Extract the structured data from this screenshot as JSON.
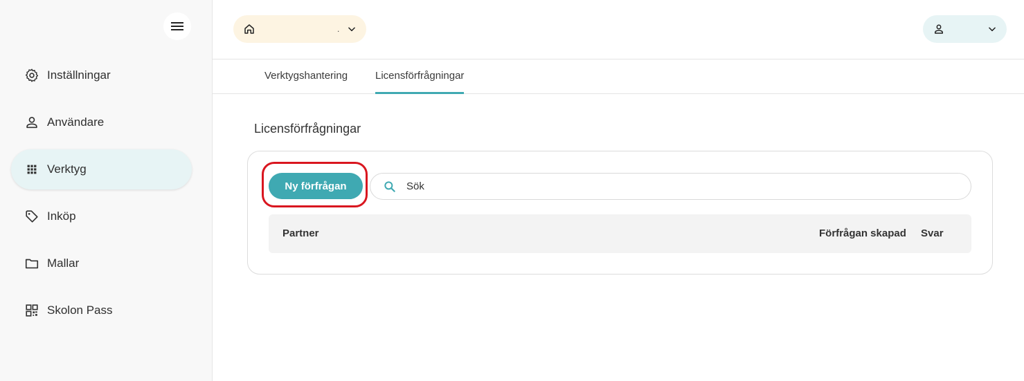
{
  "sidebar": {
    "items": [
      {
        "label": "Inställningar",
        "icon": "gear-icon",
        "active": false
      },
      {
        "label": "Användare",
        "icon": "person-icon",
        "active": false
      },
      {
        "label": "Verktyg",
        "icon": "apps-grid-icon",
        "active": true
      },
      {
        "label": "Inköp",
        "icon": "tag-icon",
        "active": false
      },
      {
        "label": "Mallar",
        "icon": "folder-icon",
        "active": false
      },
      {
        "label": "Skolon Pass",
        "icon": "qr-code-icon",
        "active": false
      }
    ]
  },
  "header": {
    "org_selector": {
      "text": "."
    },
    "user_selector": {
      "text": ""
    }
  },
  "tabs": [
    {
      "label": "Verktygshantering",
      "active": false
    },
    {
      "label": "Licensförfrågningar",
      "active": true
    }
  ],
  "page": {
    "title": "Licensförfrågningar",
    "new_request_label": "Ny förfrågan",
    "search_placeholder": "Sök",
    "table": {
      "columns": [
        "Partner",
        "Förfrågan skapad",
        "Svar"
      ]
    }
  },
  "colors": {
    "accent": "#3fa9b2",
    "highlight": "#d9161f",
    "org_bg": "#fdf4e2",
    "active_nav_bg": "#e7f4f5"
  }
}
